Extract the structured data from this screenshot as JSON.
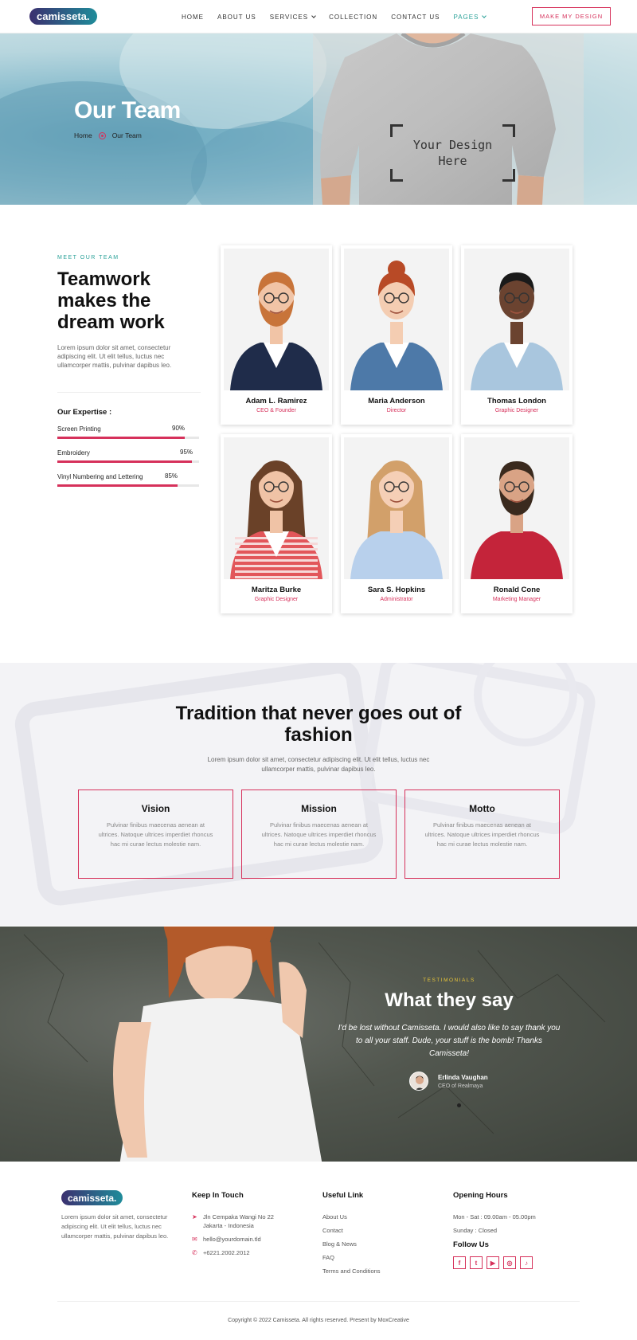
{
  "header": {
    "logo": "camisseta.",
    "nav": [
      {
        "label": "HOME",
        "dropdown": false,
        "active": false
      },
      {
        "label": "ABOUT US",
        "dropdown": false,
        "active": false
      },
      {
        "label": "SERVICES",
        "dropdown": true,
        "active": false
      },
      {
        "label": "COLLECTION",
        "dropdown": false,
        "active": false
      },
      {
        "label": "CONTACT US",
        "dropdown": false,
        "active": false
      },
      {
        "label": "PAGES",
        "dropdown": true,
        "active": true
      }
    ],
    "cta": "MAKE MY DESIGN"
  },
  "hero": {
    "title": "Our Team",
    "breadcrumb_home": "Home",
    "breadcrumb_current": "Our Team",
    "mockup_line1": "Your Design",
    "mockup_line2": "Here"
  },
  "team": {
    "eyebrow": "MEET OUR TEAM",
    "heading": "Teamwork makes the dream work",
    "intro": "Lorem ipsum dolor sit amet, consectetur adipiscing elit. Ut elit tellus, luctus nec ullamcorper mattis, pulvinar dapibus leo.",
    "expertise_title": "Our Expertise :",
    "skills": [
      {
        "name": "Screen Printing",
        "label": "90%",
        "value": 0.9
      },
      {
        "name": "Embroidery",
        "label": "95%",
        "value": 0.95
      },
      {
        "name": "Vinyl Numbering and Lettering",
        "label": "85%",
        "value": 0.85
      }
    ],
    "members": [
      {
        "name": "Adam L. Ramirez",
        "role": "CEO & Founder"
      },
      {
        "name": "Maria Anderson",
        "role": "Director"
      },
      {
        "name": "Thomas London",
        "role": "Graphic Designer"
      },
      {
        "name": "Maritza Burke",
        "role": "Graphic Designer"
      },
      {
        "name": "Sara S. Hopkins",
        "role": "Administrator"
      },
      {
        "name": "Ronald Cone",
        "role": "Marketing Manager"
      }
    ]
  },
  "tradition": {
    "heading": "Tradition that never goes out of fashion",
    "text": "Lorem ipsum dolor sit amet, consectetur adipiscing elit. Ut elit tellus, luctus nec ullamcorper mattis, pulvinar dapibus leo.",
    "boxes": [
      {
        "title": "Vision",
        "text": "Pulvinar finibus maecenas aenean at ultrices. Natoque ultrices imperdiet rhoncus hac mi curae lectus molestie nam."
      },
      {
        "title": "Mission",
        "text": "Pulvinar finibus maecenas aenean at ultrices. Natoque ultrices imperdiet rhoncus hac mi curae lectus molestie nam."
      },
      {
        "title": "Motto",
        "text": "Pulvinar finibus maecenas aenean at ultrices. Natoque ultrices imperdiet rhoncus hac mi curae lectus molestie nam."
      }
    ]
  },
  "testimonial": {
    "eyebrow": "TESTIMONIALS",
    "heading": "What they say",
    "quote": "I'd be lost without Camisseta. I would also like to say thank you to all your staff. Dude, your stuff is the bomb! Thanks Camisseta!",
    "name": "Erlinda Vaughan",
    "role": "CEO of Realmaya"
  },
  "footer": {
    "logo": "camisseta.",
    "about": "Lorem ipsum dolor sit amet, consectetur adipiscing elit. Ut elit tellus, luctus nec ullamcorper mattis, pulvinar dapibus leo.",
    "keep_title": "Keep In Touch",
    "address": "Jln Cempaka Wangi No 22 Jakarta - Indonesia",
    "email": "hello@yourdomain.tld",
    "phone": "+6221.2002.2012",
    "links_title": "Useful Link",
    "links": [
      "About Us",
      "Contact",
      "Blog & News",
      "FAQ",
      "Terms and Conditions"
    ],
    "hours_title": "Opening Hours",
    "hours_weekday": "Mon - Sat : 09.00am - 05.00pm",
    "hours_sunday": "Sunday : Closed",
    "follow_title": "Follow Us",
    "socials": [
      {
        "name": "facebook-icon",
        "glyph": "f"
      },
      {
        "name": "twitter-icon",
        "glyph": "t"
      },
      {
        "name": "youtube-icon",
        "glyph": "▶"
      },
      {
        "name": "instagram-icon",
        "glyph": "◎"
      },
      {
        "name": "tiktok-icon",
        "glyph": "♪"
      }
    ],
    "copyright": "Copyright © 2022 Camisseta. All rights reserved. Present by MoxCreative"
  },
  "colors": {
    "accent": "#d6315b",
    "teal": "#2aa198",
    "gold": "#e8c53a"
  }
}
